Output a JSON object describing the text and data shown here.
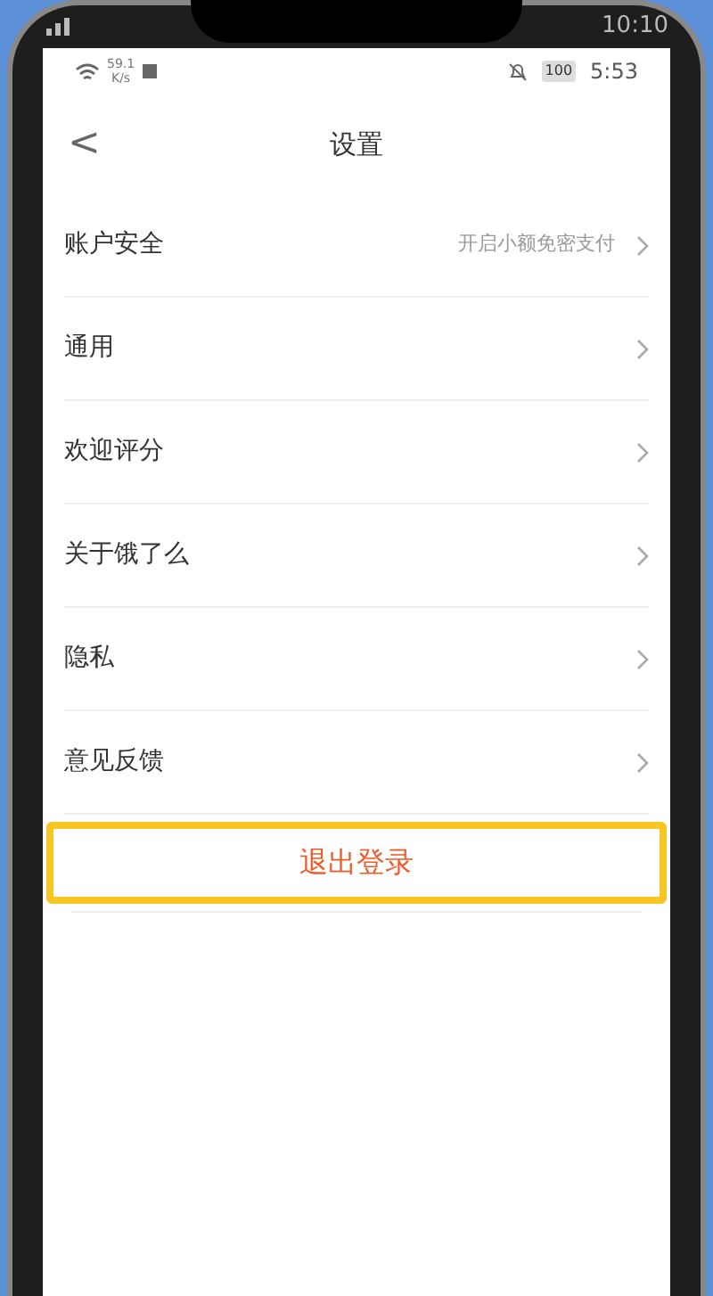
{
  "outer_status_bar": {
    "time": "10:10"
  },
  "status_bar": {
    "speed": "59.1",
    "speed_unit": "K/s",
    "battery": "100",
    "time": "5:53"
  },
  "header": {
    "back": "<",
    "title": "设置"
  },
  "settings": [
    {
      "label": "账户安全",
      "value": "开启小额免密支付"
    },
    {
      "label": "通用"
    },
    {
      "label": "欢迎评分"
    },
    {
      "label": "关于饿了么"
    },
    {
      "label": "隐私"
    },
    {
      "label": "意见反馈"
    }
  ],
  "logout": {
    "label": "退出登录",
    "highlighted": true
  }
}
